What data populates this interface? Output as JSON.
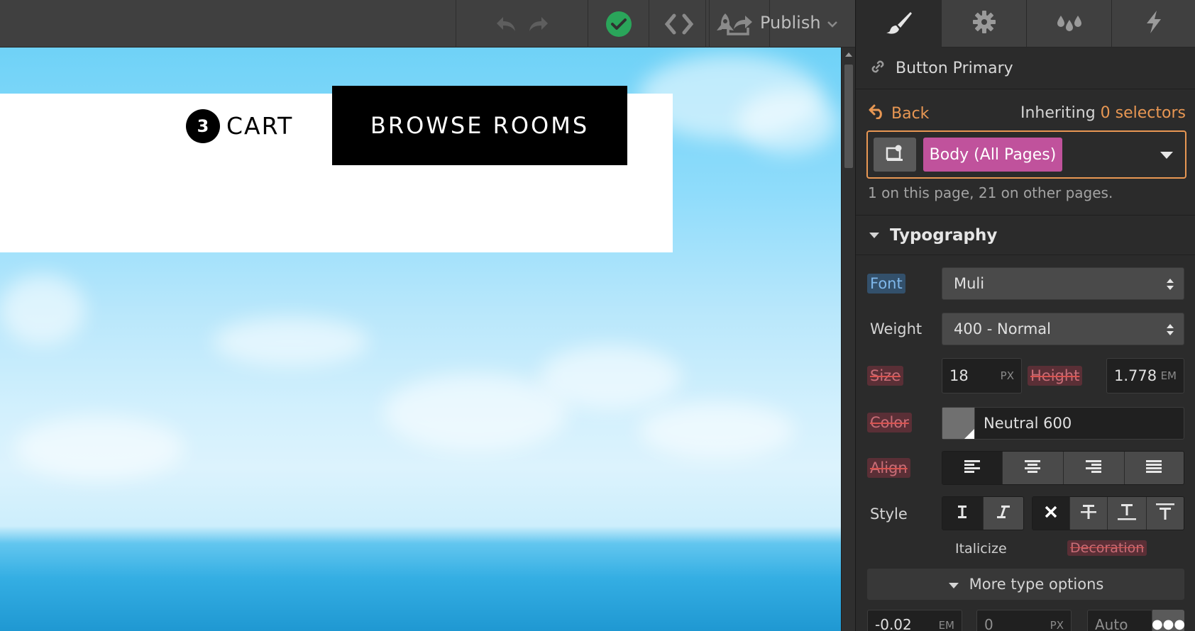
{
  "toolbar": {
    "publish_label": "Publish",
    "icons": [
      "undo-icon",
      "redo-icon",
      "check-icon",
      "code-icon",
      "export-icon",
      "rocket-icon",
      "chevron-down-icon"
    ],
    "colors": {
      "bg": "#404040",
      "check": "#2aa55a"
    }
  },
  "canvas": {
    "cart_count": "3",
    "cart_label": "CART",
    "browse_button": "BROWSE ROOMS"
  },
  "panel": {
    "tabs": [
      {
        "name": "style",
        "icon": "paintbrush-icon",
        "active": true
      },
      {
        "name": "settings",
        "icon": "gear-icon",
        "active": false
      },
      {
        "name": "interactions",
        "icon": "drops-icon",
        "active": false
      },
      {
        "name": "lightning",
        "icon": "lightning-icon",
        "active": false
      }
    ],
    "element_name": "Button Primary",
    "back_label": "Back",
    "inheriting_prefix": "Inheriting",
    "inheriting_count": "0 selectors",
    "selector_tag": "Body (All Pages)",
    "selector_note": "1 on this page, 21 on other pages.",
    "accent_color": "#e89753",
    "tag_color": "#c0529c"
  },
  "typography": {
    "title": "Typography",
    "font_label": "Font",
    "font_value": "Muli",
    "weight_label": "Weight",
    "weight_value": "400 - Normal",
    "size_label": "Size",
    "size_value": "18",
    "size_unit": "PX",
    "height_label": "Height",
    "height_value": "1.778",
    "height_unit": "EM",
    "color_label": "Color",
    "color_name": "Neutral 600",
    "color_swatch": "#707070",
    "align_label": "Align",
    "align_selected": "left",
    "style_label": "Style",
    "italicize_label": "Italicize",
    "decoration_label": "Decoration",
    "more_options": "More type options",
    "letter_spacing_value": "-0.02",
    "letter_spacing_unit": "EM",
    "indent_placeholder": "0",
    "indent_unit": "PX",
    "columns_placeholder": "Auto"
  }
}
